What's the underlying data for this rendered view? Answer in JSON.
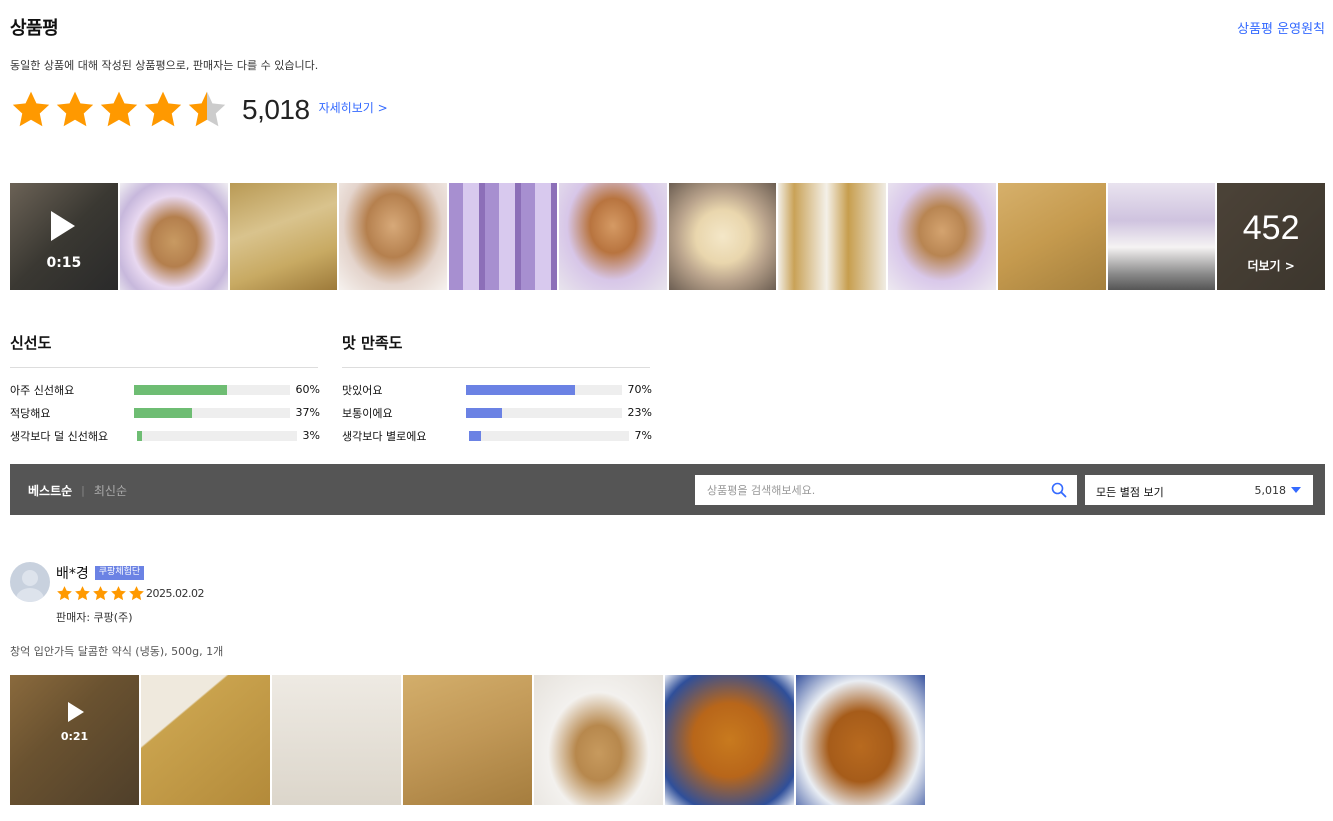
{
  "header": {
    "title": "상품평",
    "policy_link": "상품평 운영원칙",
    "description": "동일한 상품에 대해 작성된 상품평으로, 판매자는 다를 수 있습니다."
  },
  "rating": {
    "average_stars": 4.5,
    "max_stars": 5,
    "count": "5,018",
    "detail_link": "자세히보기 >",
    "star_color": "#ff9900",
    "star_empty_color": "#cccccc"
  },
  "photo_strip": {
    "video_duration": "0:15",
    "more_count": "452",
    "more_label": "더보기 >"
  },
  "summaries": {
    "freshness": {
      "title": "신선도",
      "color": "#6ebd73",
      "rows": [
        {
          "label": "아주 신선해요",
          "percent": 60,
          "percent_text": "60%"
        },
        {
          "label": "적당해요",
          "percent": 37,
          "percent_text": "37%"
        },
        {
          "label": "생각보다 덜 신선해요",
          "percent": 3,
          "percent_text": "3%"
        }
      ]
    },
    "taste": {
      "title": "맛 만족도",
      "color": "#6b82e4",
      "rows": [
        {
          "label": "맛있어요",
          "percent": 70,
          "percent_text": "70%"
        },
        {
          "label": "보통이에요",
          "percent": 23,
          "percent_text": "23%"
        },
        {
          "label": "생각보다 별로에요",
          "percent": 7,
          "percent_text": "7%"
        }
      ]
    }
  },
  "toolbar": {
    "sort_best": "베스트순",
    "sort_separator": "|",
    "sort_latest": "최신순",
    "search_placeholder": "상품평을 검색해보세요.",
    "filter_label": "모든 별점 보기",
    "filter_count": "5,018"
  },
  "review": {
    "name": "배*경",
    "badge": "쿠팡체험단",
    "stars": 5,
    "date": "2025.02.02",
    "seller": "판매자: 쿠팡(주)",
    "product": "창억 입안가득 달콤한 약식 (냉동), 500g, 1개",
    "video_duration": "0:21"
  },
  "icons": {
    "search": "search-icon",
    "play": "play-icon",
    "caret": "caret-down-icon",
    "star": "star-icon"
  }
}
